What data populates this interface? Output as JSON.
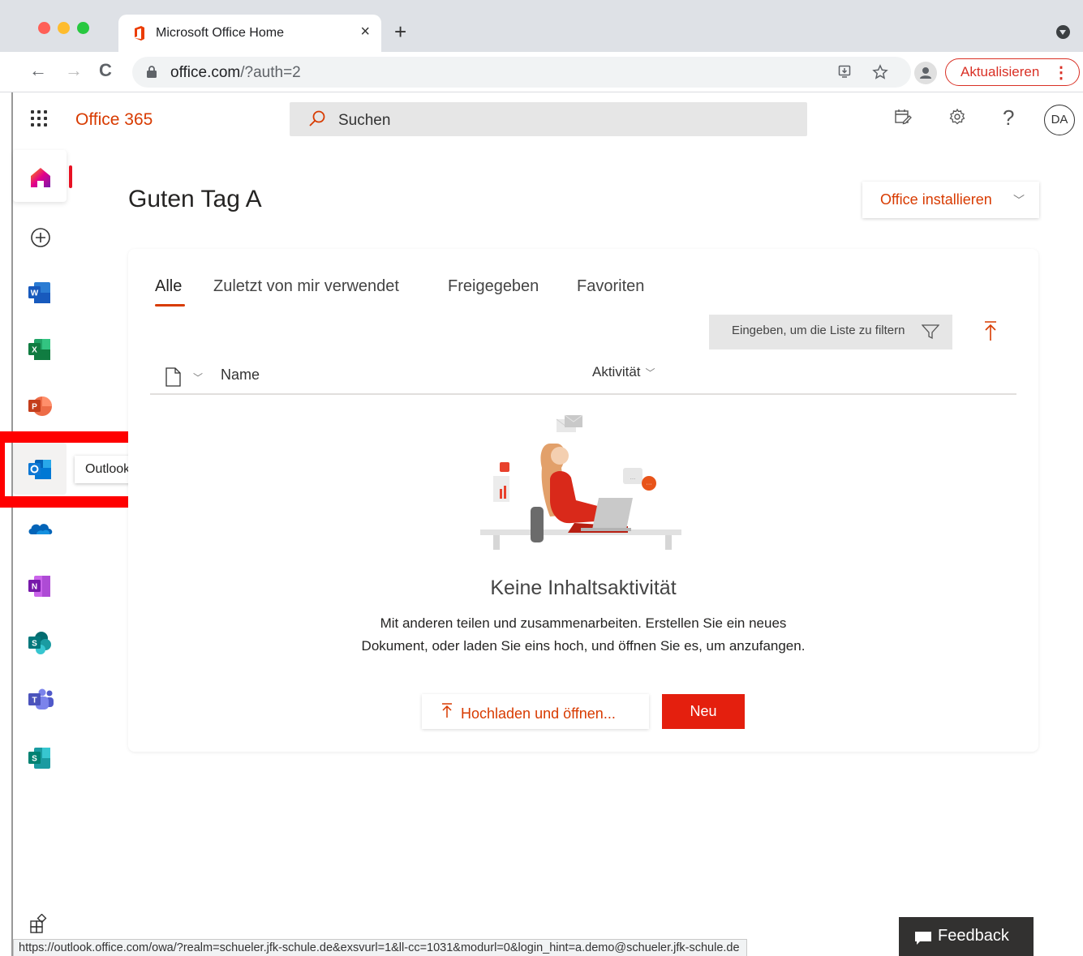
{
  "browser": {
    "tab_title": "Microsoft Office Home",
    "tab_close": "×",
    "new_tab": "+",
    "nav_back": "←",
    "nav_forward": "→",
    "nav_reload": "C",
    "url_host": "office.com",
    "url_path": "/?auth=2",
    "update_label": "Aktualisieren",
    "update_menu": "⋮",
    "status_url": "https://outlook.office.com/owa/?realm=schueler.jfk-schule.de&exsvurl=1&ll-cc=1031&modurl=0&login_hint=a.demo@schueler.jfk-schule.de"
  },
  "header": {
    "brand": "Office 365",
    "search_placeholder": "Suchen",
    "user_initials": "DA",
    "help": "?"
  },
  "rail": {
    "apps": [
      "home",
      "create",
      "word",
      "excel",
      "powerpoint",
      "outlook",
      "onedrive",
      "onenote",
      "sharepoint",
      "teams",
      "sway"
    ],
    "tooltip": "Outlook"
  },
  "main": {
    "greeting": "Guten Tag A",
    "install_label": "Office installieren",
    "tabs": [
      {
        "label": "Alle",
        "active": true
      },
      {
        "label": "Zuletzt von mir verwendet",
        "active": false
      },
      {
        "label": "Freigegeben",
        "active": false
      },
      {
        "label": "Favoriten",
        "active": false
      }
    ],
    "filter_placeholder": "Eingeben, um die Liste zu filtern",
    "columns": {
      "name": "Name",
      "activity": "Aktivität"
    },
    "empty_title": "Keine Inhaltsaktivität",
    "empty_desc": "Mit anderen teilen und zusammenarbeiten. Erstellen Sie ein neues Dokument, oder laden Sie eins hoch, und öffnen Sie es, um anzufangen.",
    "upload_label": "Hochladen und öffnen...",
    "new_label": "Neu"
  },
  "feedback": {
    "label": "Feedback"
  },
  "colors": {
    "accent": "#d83b01",
    "primary_button": "#e41f0e",
    "annotation": "#ff0000"
  }
}
